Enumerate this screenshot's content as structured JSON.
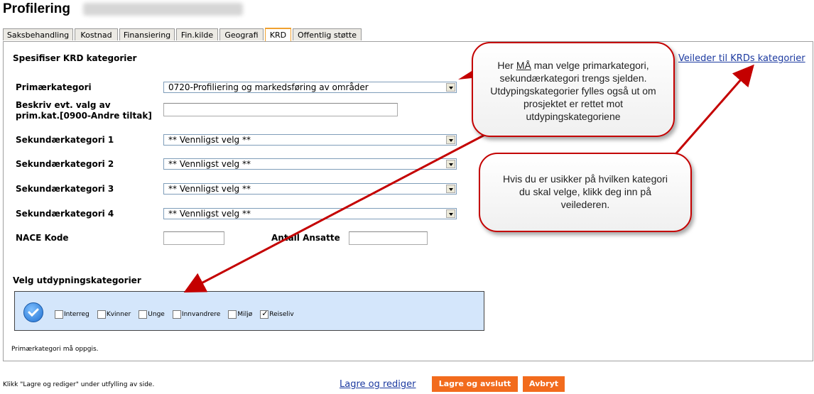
{
  "header": {
    "title": "Profilering"
  },
  "tabs": [
    {
      "label": "Saksbehandling"
    },
    {
      "label": "Kostnad"
    },
    {
      "label": "Finansiering"
    },
    {
      "label": "Fin.kilde"
    },
    {
      "label": "Geografi"
    },
    {
      "label": "KRD",
      "active": true
    },
    {
      "label": "Offentlig støtte"
    }
  ],
  "form": {
    "section_title": "Spesifiser KRD kategorier",
    "guide_link": "Veileder til KRDs kategorier",
    "primary_label": "Primærkategori",
    "primary_value": "0720-Profiliering og markedsføring av områder",
    "describe_label_1": "Beskriv evt. valg av",
    "describe_label_2": "prim.kat.[0900-Andre tiltak]",
    "describe_value": "",
    "secondary": [
      {
        "label": "Sekundærkategori 1",
        "value": "** Vennligst velg **"
      },
      {
        "label": "Sekundærkategori 2",
        "value": "** Vennligst velg **"
      },
      {
        "label": "Sekundærkategori 3",
        "value": "** Vennligst velg **"
      },
      {
        "label": "Sekundærkategori 4",
        "value": "** Vennligst velg **"
      }
    ],
    "nace_label": "NACE Kode",
    "nace_value": "",
    "employees_label": "Antall Ansatte",
    "employees_value": ""
  },
  "detail": {
    "title": "Velg utdypningskategorier",
    "options": [
      {
        "label": "Interreg",
        "checked": false
      },
      {
        "label": "Kvinner",
        "checked": false
      },
      {
        "label": "Unge",
        "checked": false
      },
      {
        "label": "Innvandrere",
        "checked": false
      },
      {
        "label": "Miljø",
        "checked": false
      },
      {
        "label": "Reiseliv",
        "checked": true
      }
    ]
  },
  "validation": "Primærkategori må oppgis.",
  "footer": {
    "hint": "Klikk \"Lagre og rediger\" under utfylling av side.",
    "save_edit": "Lagre og rediger",
    "save_close": "Lagre og avslutt",
    "cancel": "Avbryt"
  },
  "callouts": {
    "c1_pre": "Her ",
    "c1_em": "MÅ",
    "c1_post": " man velge primarkategori, sekundærkategori trengs sjelden. Utdypingskategorier fylles også ut om prosjektet er rettet mot utdypingskategoriene",
    "c2": "Hvis du er usikker på hvilken kategori du skal velge, klikk deg inn på veilederen."
  },
  "colors": {
    "accent": "#f26b1d",
    "arrow": "#c40000",
    "link": "#1c3aa0",
    "panel_bg": "#d4e6fb"
  }
}
